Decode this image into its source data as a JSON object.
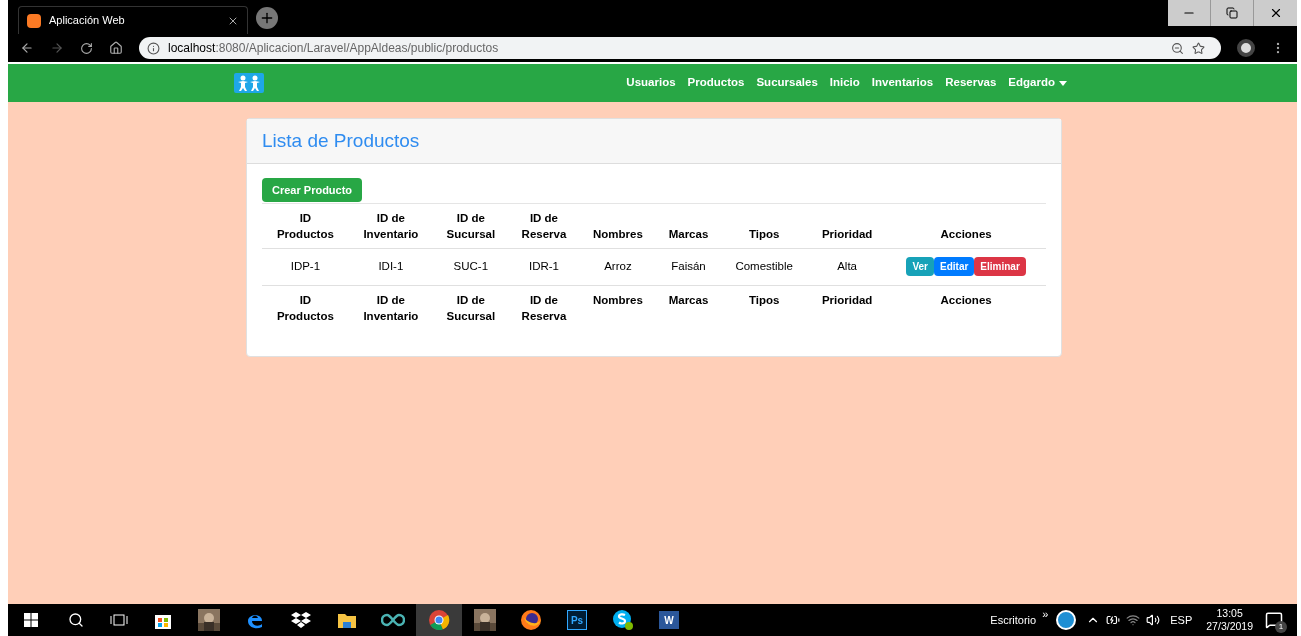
{
  "browser": {
    "tab_title": "Aplicación Web",
    "url_host": "localhost",
    "url_path": ":8080/Aplicacion/Laravel/AppAldeas/public/productos"
  },
  "navbar": {
    "items": [
      {
        "label": "Usuarios",
        "dropdown": false
      },
      {
        "label": "Productos",
        "dropdown": false
      },
      {
        "label": "Sucursales",
        "dropdown": false
      },
      {
        "label": "Inicio",
        "dropdown": false
      },
      {
        "label": "Inventarios",
        "dropdown": false
      },
      {
        "label": "Reservas",
        "dropdown": false
      },
      {
        "label": "Edgardo",
        "dropdown": true
      }
    ]
  },
  "card": {
    "title": "Lista de Productos",
    "create_button": "Crear Producto",
    "table": {
      "columns": [
        "ID\nProductos",
        "ID de\nInventario",
        "ID de\nSucursal",
        "ID de\nReserva",
        "Nombres",
        "Marcas",
        "Tipos",
        "Prioridad",
        "Acciones"
      ],
      "rows": [
        {
          "cells": [
            "IDP-1",
            "IDI-1",
            "SUC-1",
            "IDR-1",
            "Arroz",
            "Faisán",
            "Comestible",
            "Alta"
          ],
          "actions": [
            {
              "label": "Ver",
              "kind": "info"
            },
            {
              "label": "Editar",
              "kind": "primary"
            },
            {
              "label": "Eliminar",
              "kind": "danger"
            }
          ]
        }
      ],
      "footer": [
        "ID\nProductos",
        "ID de\nInventario",
        "ID de\nSucursal",
        "ID de\nReserva",
        "Nombres",
        "Marcas",
        "Tipos",
        "Prioridad",
        "Acciones"
      ]
    }
  },
  "taskbar": {
    "apps": [
      {
        "kind": "store",
        "selected": false
      },
      {
        "kind": "picture",
        "selected": false
      },
      {
        "kind": "edge",
        "selected": false
      },
      {
        "kind": "dropbox",
        "selected": false
      },
      {
        "kind": "folder",
        "selected": false
      },
      {
        "kind": "infinity",
        "selected": false
      },
      {
        "kind": "chrome",
        "selected": true
      },
      {
        "kind": "picture",
        "selected": false
      },
      {
        "kind": "firefox",
        "selected": false
      },
      {
        "kind": "ps",
        "label": "Ps",
        "selected": false
      },
      {
        "kind": "skype",
        "selected": false
      },
      {
        "kind": "word",
        "label": "W",
        "selected": false
      }
    ],
    "desktop_label": "Escritorio",
    "chevrons": "»",
    "language": "ESP",
    "time": "13:05",
    "date": "27/3/2019",
    "notifications": "1"
  }
}
